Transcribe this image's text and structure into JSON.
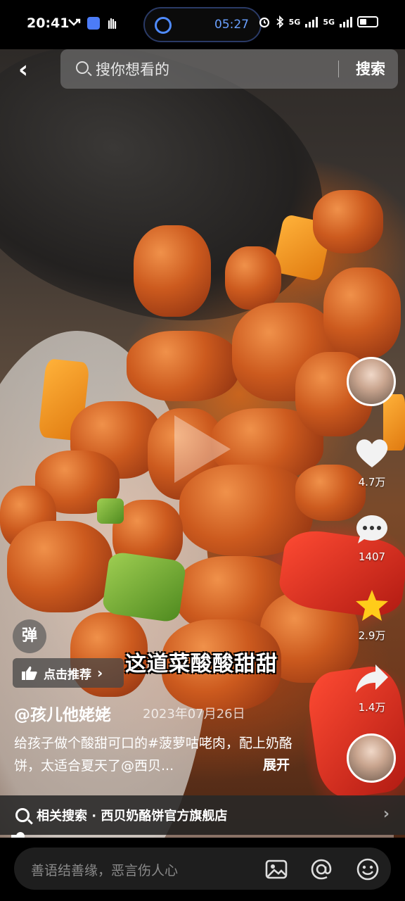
{
  "status_bar": {
    "time": "20:41",
    "island_time": "05:27",
    "net1": "5G",
    "net2": "5G"
  },
  "search": {
    "placeholder": "搜你想看的",
    "button": "搜索"
  },
  "actions": {
    "like_count": "4.7万",
    "comment_count": "1407",
    "favorite_count": "2.9万",
    "share_count": "1.4万"
  },
  "overlay": {
    "danmu_label": "弹",
    "recommend_label": "点击推荐",
    "caption": "这道菜酸酸甜甜"
  },
  "post": {
    "author": "@孩儿他姥姥",
    "date": "2023年07月26日",
    "description": "给孩子做个酸甜可口的#菠萝咕咾肉，配上奶酪饼，太适合夏天了@西贝...",
    "expand": "展开"
  },
  "related": {
    "text": "相关搜索 · 西贝奶酪饼官方旗舰店"
  },
  "progress": 0.02,
  "comment_bar": {
    "placeholder": "善语结善缘，恶言伤人心"
  },
  "colors": {
    "accent_blue": "#4f8bff",
    "favorite_yellow": "#ffcc1a"
  }
}
